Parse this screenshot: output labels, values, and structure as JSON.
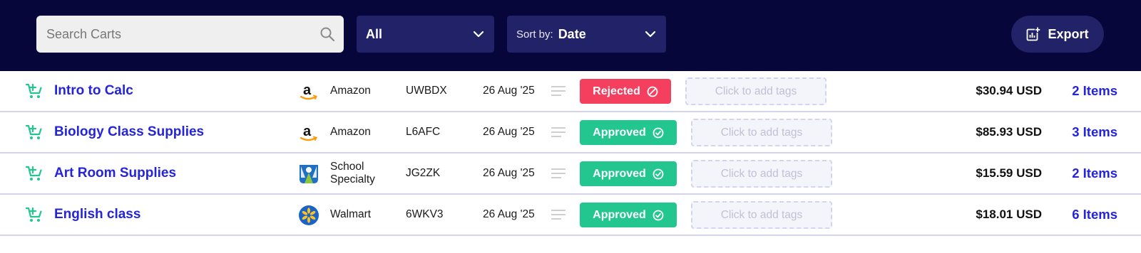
{
  "toolbar": {
    "search": {
      "placeholder": "Search Carts",
      "value": "",
      "icon": "search-icon"
    },
    "filter": {
      "value": "All",
      "icon": "chevron-down-icon"
    },
    "sort": {
      "label": "Sort by:",
      "value": "Date",
      "icon": "chevron-down-icon"
    },
    "export": {
      "label": "Export",
      "icon": "export-chart-icon"
    }
  },
  "colors": {
    "header_bg": "#06063a",
    "control_bg": "#222268",
    "link_blue": "#2424dc",
    "cart_green": "#22c68e",
    "approved_green": "#22c68e",
    "rejected_red": "#f43f5e"
  },
  "carts": [
    {
      "name": "Intro to Calc",
      "vendor": "Amazon",
      "vendor_logo": "amazon-logo",
      "code": "UWBDX",
      "date": "26 Aug '25",
      "status": "Rejected",
      "status_type": "rejected",
      "tags_placeholder": "Click to add tags",
      "price": "$30.94 USD",
      "items": "2 Items"
    },
    {
      "name": "Biology Class Supplies",
      "vendor": "Amazon",
      "vendor_logo": "amazon-logo",
      "code": "L6AFC",
      "date": "26 Aug '25",
      "status": "Approved",
      "status_type": "approved",
      "tags_placeholder": "Click to add tags",
      "price": "$85.93 USD",
      "items": "3 Items"
    },
    {
      "name": "Art Room Supplies",
      "vendor_line1": "School",
      "vendor_line2": "Specialty",
      "vendor_logo": "school-specialty-logo",
      "code": "JG2ZK",
      "date": "26 Aug '25",
      "status": "Approved",
      "status_type": "approved",
      "tags_placeholder": "Click to add tags",
      "price": "$15.59 USD",
      "items": "2 Items"
    },
    {
      "name": "English class",
      "vendor": "Walmart",
      "vendor_logo": "walmart-logo",
      "code": "6WKV3",
      "date": "26 Aug '25",
      "status": "Approved",
      "status_type": "approved",
      "tags_placeholder": "Click to add tags",
      "price": "$18.01 USD",
      "items": "6 Items"
    }
  ]
}
